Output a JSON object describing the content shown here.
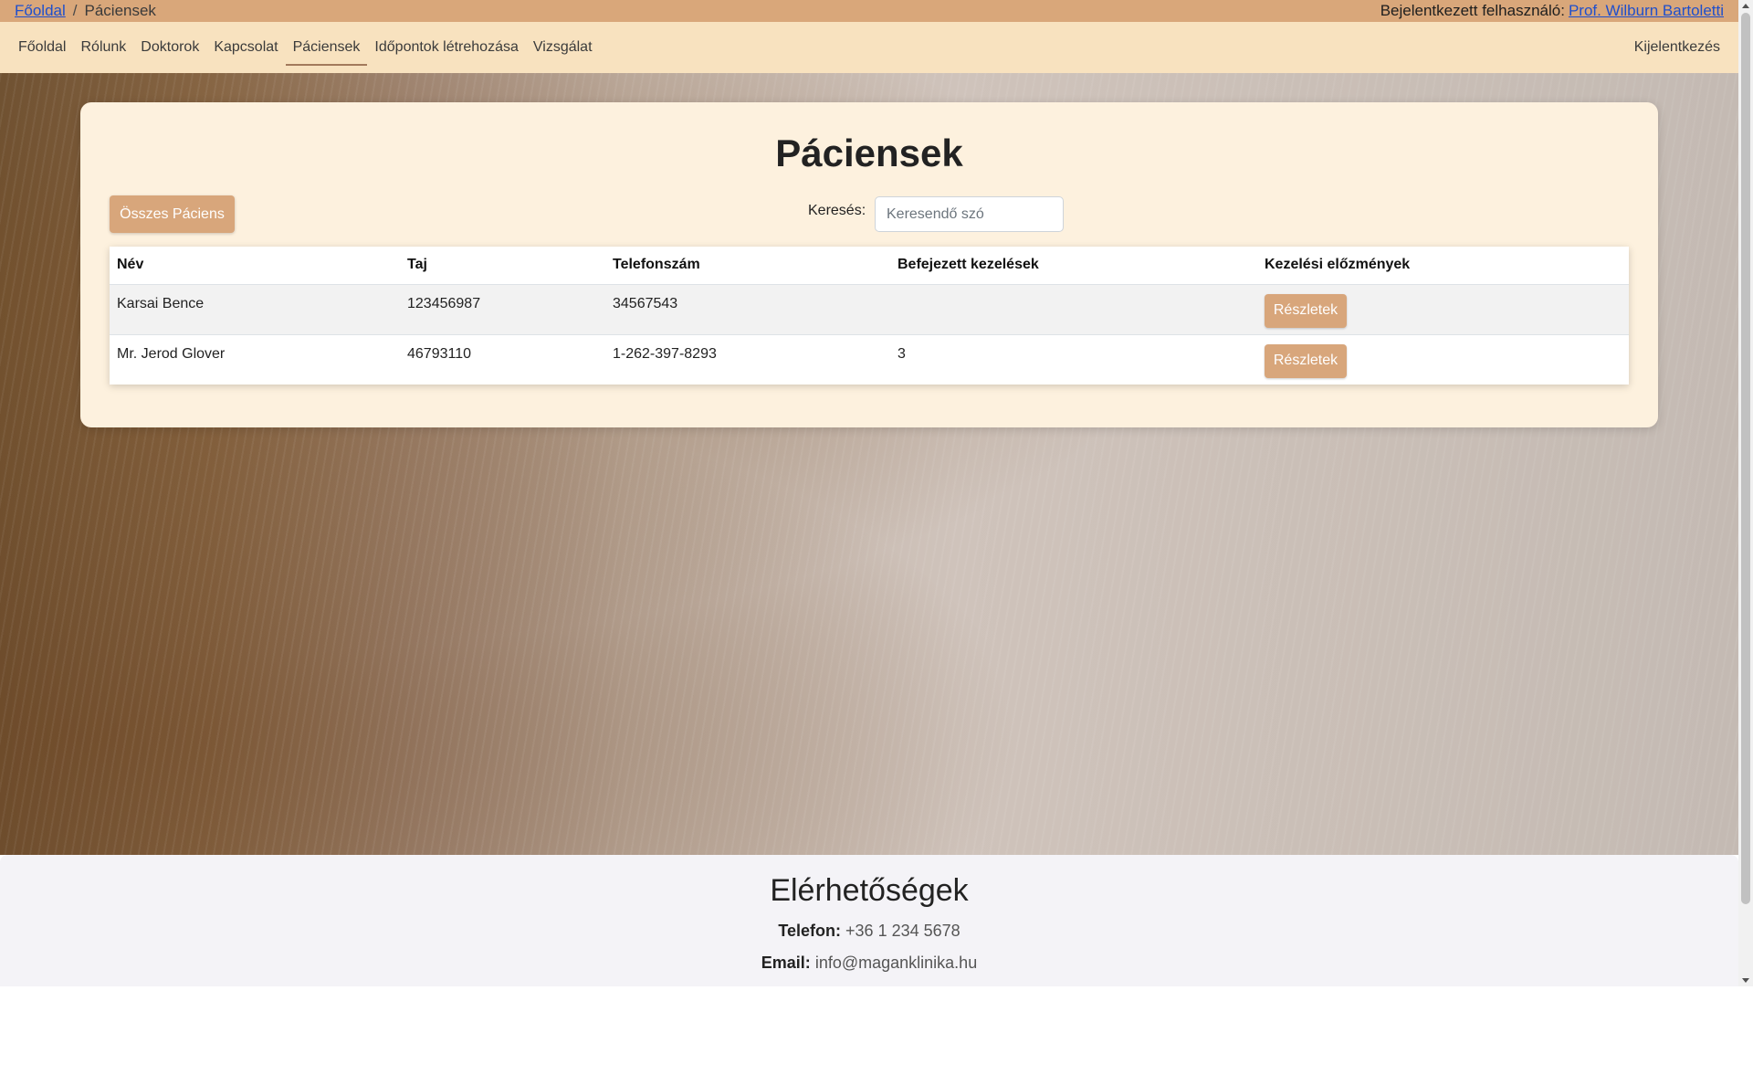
{
  "breadcrumb": {
    "home": "Főoldal",
    "separator": "/",
    "current": "Páciensek"
  },
  "user": {
    "label": "Bejelentkezett felhasználó:",
    "name": "Prof. Wilburn Bartoletti"
  },
  "nav": {
    "items": [
      "Főoldal",
      "Rólunk",
      "Doktorok",
      "Kapcsolat",
      "Páciensek",
      "Időpontok létrehozása",
      "Vizsgálat"
    ],
    "active": "Páciensek",
    "logout": "Kijelentkezés"
  },
  "main": {
    "title": "Páciensek",
    "all_button": "Összes Páciens",
    "search_label": "Keresés:",
    "search_placeholder": "Keresendő szó",
    "table": {
      "headers": [
        "Név",
        "Taj",
        "Telefonszám",
        "Befejezett kezelések",
        "Kezelési előzmények"
      ],
      "rows": [
        {
          "name": "Karsai Bence",
          "taj": "123456987",
          "phone": "34567543",
          "completed": "",
          "action": "Részletek"
        },
        {
          "name": "Mr. Jerod Glover",
          "taj": "46793110",
          "phone": "1-262-397-8293",
          "completed": "3",
          "action": "Részletek"
        }
      ]
    }
  },
  "footer": {
    "title": "Elérhetőségek",
    "phone_label": "Telefon:",
    "phone": "+36 1 234 5678",
    "email_label": "Email:",
    "email": "info@maganklinika.hu"
  },
  "colors": {
    "topbar": "#d9a77a",
    "navbar": "#f8e2bf",
    "accent": "#d8a67b",
    "card": "#fdf1de",
    "link": "#1f4fcc"
  }
}
